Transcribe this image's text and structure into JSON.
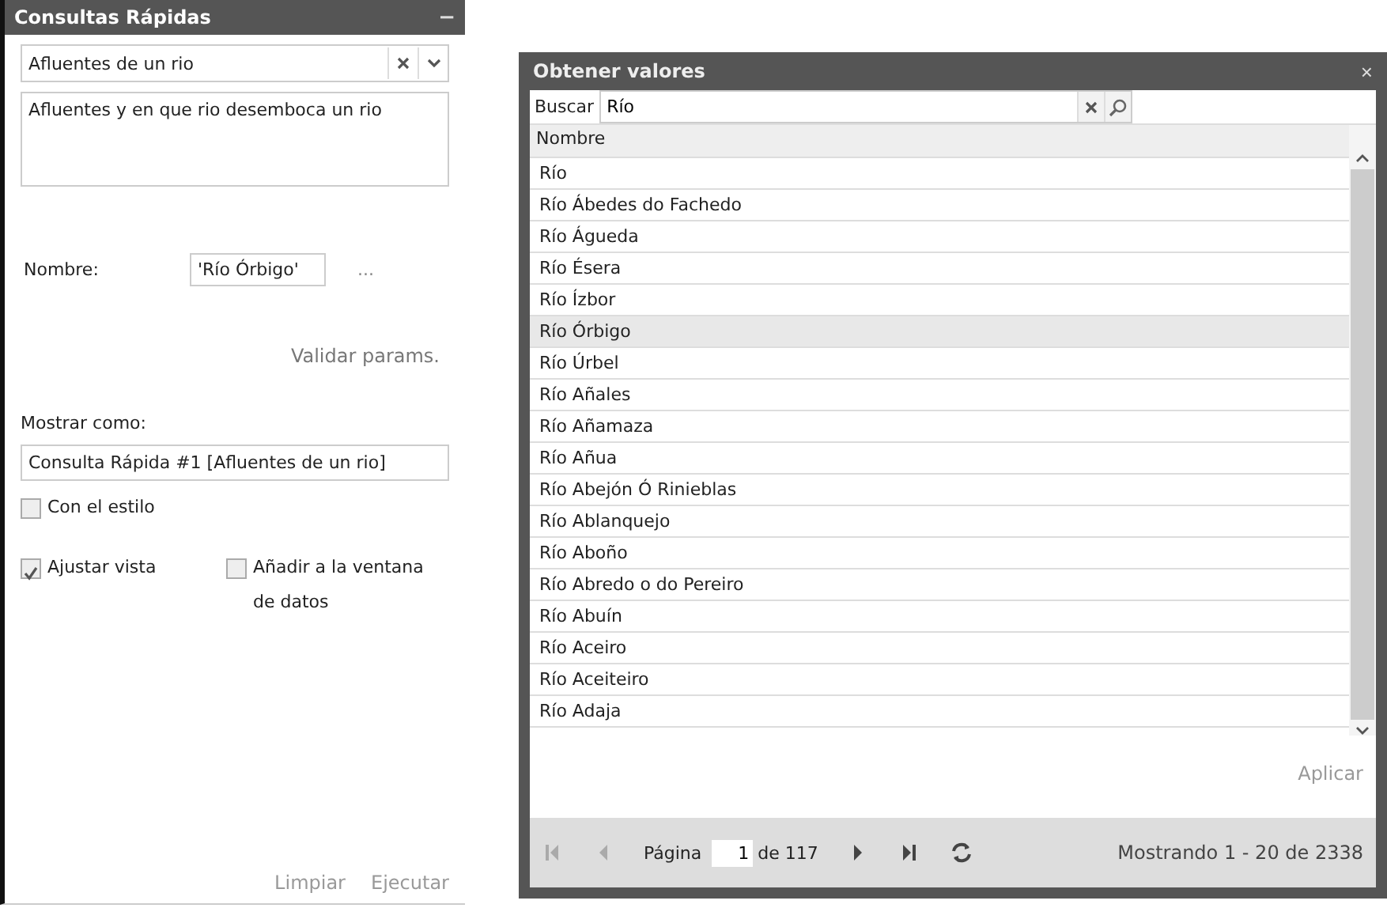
{
  "panel": {
    "title": "Consultas Rápidas",
    "collapse_icon": "−",
    "query_select": "Afluentes de un rio",
    "description": "Afluentes y en que rio desemboca un rio",
    "param": {
      "label": "Nombre:",
      "value": "'Río Órbigo'",
      "more": "..."
    },
    "validate": "Validar params.",
    "show_as_label": "Mostrar como:",
    "show_as_value": "Consulta Rápida #1 [Afluentes de un rio]",
    "checkboxes": [
      {
        "label": "Con el estilo",
        "checked": false
      },
      {
        "label": "Ajustar vista",
        "checked": true
      },
      {
        "label": "Añadir a la ventana de datos",
        "checked": false
      }
    ],
    "buttons": [
      "Limpiar",
      "Ejecutar"
    ]
  },
  "dialog": {
    "title": "Obtener valores",
    "close": "×",
    "search": {
      "label": "Buscar",
      "value": "Río"
    },
    "column": "Nombre",
    "rows": [
      {
        "name": "Río",
        "selected": false
      },
      {
        "name": "Río Ábedes do Fachedo",
        "selected": false
      },
      {
        "name": "Río Águeda",
        "selected": false
      },
      {
        "name": "Río Ésera",
        "selected": false
      },
      {
        "name": "Río Ízbor",
        "selected": false
      },
      {
        "name": "Río Órbigo",
        "selected": true
      },
      {
        "name": "Río Úrbel",
        "selected": false
      },
      {
        "name": "Río Añales",
        "selected": false
      },
      {
        "name": "Río Añamaza",
        "selected": false
      },
      {
        "name": "Río Añua",
        "selected": false
      },
      {
        "name": "Río Abejón Ó Rinieblas",
        "selected": false
      },
      {
        "name": "Río Ablanquejo",
        "selected": false
      },
      {
        "name": "Río Aboño",
        "selected": false
      },
      {
        "name": "Río Abredo o do Pereiro",
        "selected": false
      },
      {
        "name": "Río Abuín",
        "selected": false
      },
      {
        "name": "Río Aceiro",
        "selected": false
      },
      {
        "name": "Río Aceiteiro",
        "selected": false
      },
      {
        "name": "Río Adaja",
        "selected": false
      }
    ],
    "apply": "Aplicar",
    "pager": {
      "page_label": "Página",
      "page": "1",
      "of": "de 117",
      "summary": "Mostrando 1 - 20 de 2338",
      "first_disabled": true,
      "prev_disabled": true
    }
  }
}
